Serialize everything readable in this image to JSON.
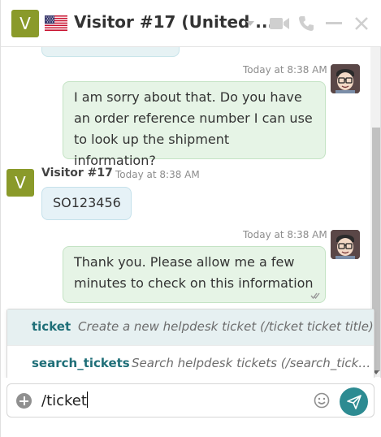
{
  "header": {
    "avatar_letter": "V",
    "flag_icon": "us-flag-icon",
    "title": "Visitor #17 (United ...",
    "icons": [
      "chevron-down-icon",
      "video-camera-icon",
      "phone-icon",
      "minimize-icon",
      "close-icon"
    ]
  },
  "messages": [
    {
      "direction": "out",
      "timestamp": "Today at 8:38 AM",
      "text": [
        "I am sorry about that. Do you have",
        "an order reference number I can use",
        "to look up the shipment information?"
      ]
    },
    {
      "direction": "in",
      "author": "Visitor #17",
      "avatar_letter": "V",
      "timestamp": "Today at 8:38 AM",
      "text": [
        "SO123456"
      ]
    },
    {
      "direction": "out",
      "timestamp": "Today at 8:38 AM",
      "text": [
        "Thank you. Please allow me a few",
        "minutes to check on this information"
      ],
      "status_icon": "double-check-icon"
    }
  ],
  "suggestions": [
    {
      "command": "ticket",
      "description": "Create a new helpdesk ticket (/ticket ticket title)"
    },
    {
      "command": "search_tickets",
      "description": "Search helpdesk tickets (/search_tick…"
    }
  ],
  "composer": {
    "value": "/ticket",
    "icons": [
      "add-icon",
      "emoji-icon",
      "send-icon"
    ]
  },
  "colors": {
    "visitor_avatar": "#8a9a2a",
    "outgoing_bubble": "#e6f4e6",
    "incoming_bubble": "#e6f2f7",
    "suggestion_highlight": "#e6f0f1",
    "command_text": "#1f6f78",
    "send_button": "#2d8b92"
  }
}
